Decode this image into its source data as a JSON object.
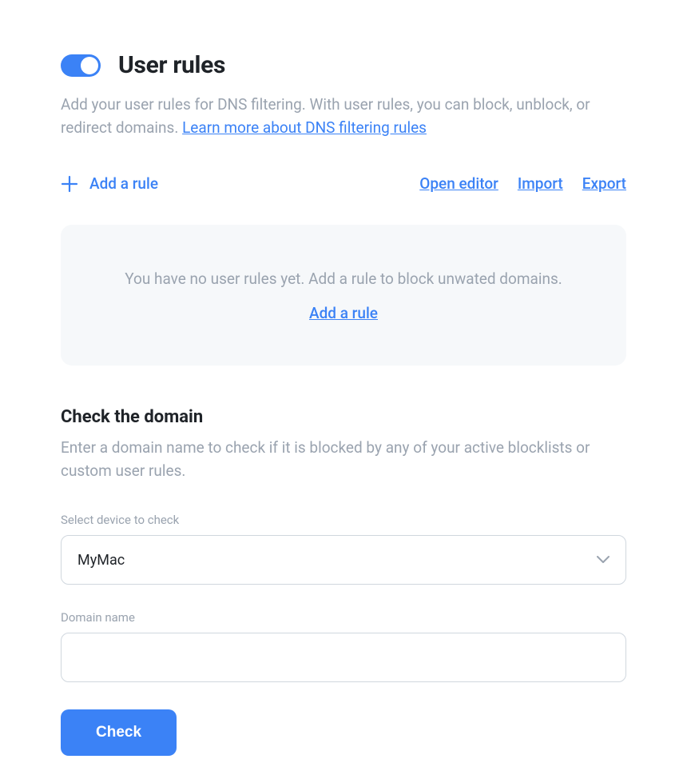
{
  "header": {
    "title": "User rules",
    "subtitle_pre": "Add your user rules for DNS filtering. With user rules, you can block, unblock, or redirect domains. ",
    "subtitle_link": "Learn more about DNS filtering rules"
  },
  "toolbar": {
    "add_rule": "Add a rule",
    "open_editor": "Open editor",
    "import": "Import",
    "export": "Export"
  },
  "empty": {
    "message": "You have no user rules yet. Add a rule to block unwated domains.",
    "action": "Add a rule"
  },
  "check": {
    "title": "Check the domain",
    "desc": "Enter a domain name to check if it is blocked by any of your active blocklists or custom user rules.",
    "device_label": "Select device to check",
    "device_value": "MyMac",
    "domain_label": "Domain name",
    "domain_value": "",
    "button": "Check"
  }
}
